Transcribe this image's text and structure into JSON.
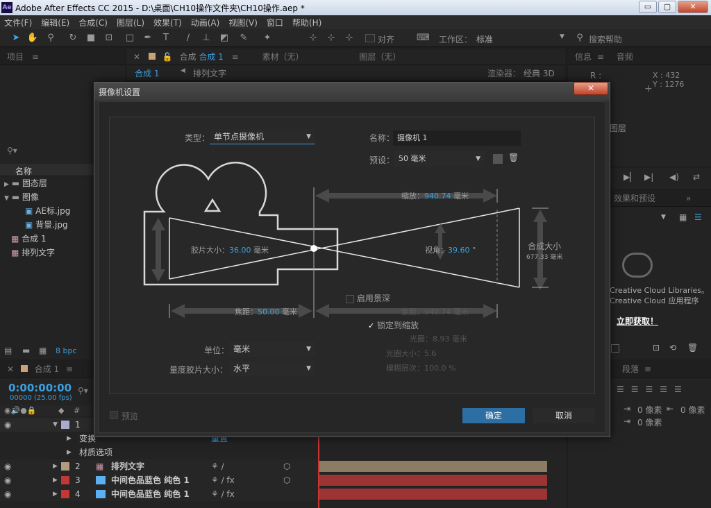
{
  "app": {
    "title": "Adobe After Effects CC 2015 - D:\\桌面\\CH10操作文件夹\\CH10操作.aep *",
    "icon": "Ae"
  },
  "window_buttons": [
    "▭",
    "▢",
    "✕"
  ],
  "menu": [
    "文件(F)",
    "编辑(E)",
    "合成(C)",
    "图层(L)",
    "效果(T)",
    "动画(A)",
    "视图(V)",
    "窗口",
    "帮助(H)"
  ],
  "toolbar": {
    "snap_label": "对齐",
    "workspace_label": "工作区：",
    "workspace_value": "标准",
    "search_placeholder": "搜索帮助"
  },
  "project_panel": {
    "title": "项目",
    "column_name": "名称",
    "items": [
      {
        "label": "固态层",
        "type": "folder",
        "expand": "▶"
      },
      {
        "label": "图像",
        "type": "folder",
        "expand": "▼"
      },
      {
        "label": "AE标.jpg",
        "type": "image"
      },
      {
        "label": "背景.jpg",
        "type": "image"
      },
      {
        "label": "合成 1",
        "type": "comp"
      },
      {
        "label": "排列文字",
        "type": "comp"
      }
    ],
    "bpc": "8 bpc"
  },
  "comp_tabs": {
    "tab1": "合成",
    "tab1_active": "合成 1",
    "tab2": "素材（无）",
    "tab3": "图层（无）",
    "breadcrumb1": "合成 1",
    "breadcrumb2": "排列文字",
    "renderer_label": "渲染器：",
    "renderer_value": "经典 3D"
  },
  "info_panel": {
    "tab1": "信息",
    "tab2": "音频",
    "r_label": "R :",
    "x_coord": "X : 432",
    "y_coord": "Y : 1276",
    "layer_partial": "图层"
  },
  "effects_panel": {
    "title": "效果和预设",
    "cc_line1": "Creative Cloud Libraries。",
    "cc_line2": "Creative Cloud 应用程序",
    "cc_link": "立即获取！"
  },
  "paragraph_panel": {
    "title": "段落",
    "indent1": "0 像素",
    "indent2": "0 像素",
    "indent3": "0 像素"
  },
  "timeline": {
    "tab": "合成 1",
    "timecode": "0:00:00:00",
    "frames": "00000 (25.00 fps)",
    "rows": [
      {
        "num": "1",
        "label": "",
        "color": "#aaaacc"
      },
      {
        "num": "",
        "label": "变换",
        "sub": "重置"
      },
      {
        "num": "",
        "label": "材质选项"
      },
      {
        "num": "2",
        "label": "排列文字",
        "color": "#b29c7d"
      },
      {
        "num": "3",
        "label": "中间色品蓝色 纯色 1",
        "color": "#c43737"
      },
      {
        "num": "4",
        "label": "中间色品蓝色 纯色 1",
        "color": "#c43737"
      }
    ]
  },
  "dialog": {
    "title": "摄像机设置",
    "close": "✕",
    "type_label": "类型：",
    "type_value": "单节点摄像机",
    "name_label": "名称：",
    "name_value": "摄像机 1",
    "preset_label": "预设：",
    "preset_value": "50 毫米",
    "zoom_label": "缩放：",
    "zoom_value": "940.74",
    "zoom_unit": "毫米",
    "film_label": "胶片大小：",
    "film_value": "36.00",
    "film_unit": "毫米",
    "angle_label": "视角：",
    "angle_value": "39.60",
    "angle_unit": "°",
    "comp_size_label": "合成大小",
    "comp_size_value": "677.33 毫米",
    "focal_label": "焦距：",
    "focal_value": "50.00",
    "focal_unit": "毫米",
    "focus_label": "焦距：",
    "focus_value": "940.74 毫米",
    "dof_label": "启用景深",
    "lock_label": "锁定到缩放",
    "aperture_label": "光圈：",
    "aperture_value": "8.93 毫米",
    "fstop_label": "光圈大小：",
    "fstop_value": "5.6",
    "blur_label": "模糊层次：",
    "blur_value": "100.0 %",
    "units_label": "单位：",
    "units_value": "毫米",
    "measure_label": "量度胶片大小：",
    "measure_value": "水平",
    "preview_label": "预览",
    "ok": "确定",
    "cancel": "取消"
  }
}
